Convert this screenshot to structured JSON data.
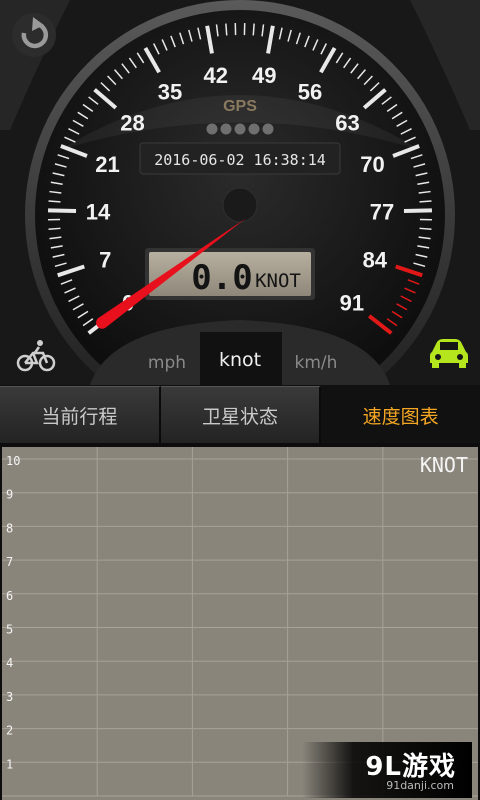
{
  "gauge": {
    "ticks": [
      "0",
      "7",
      "14",
      "21",
      "28",
      "35",
      "42",
      "49",
      "56",
      "63",
      "70",
      "77",
      "84",
      "91"
    ],
    "gps_label": "GPS",
    "datetime": "2016-06-02 16:38:14",
    "speed_value": "0.0",
    "speed_unit": "KNOT",
    "needle_speed": 0
  },
  "icons": {
    "refresh": "refresh-icon",
    "bicycle": "bicycle-icon",
    "car": "car-icon"
  },
  "colors": {
    "needle": "#e8101c",
    "redline": "#e01818",
    "active_tab": "#f5a623",
    "car_icon": "#b5e61d",
    "chart_bg": "#8a857b"
  },
  "units": {
    "mph": "mph",
    "knot": "knot",
    "kmh": "km/h",
    "selected": "knot"
  },
  "tabs": [
    {
      "label": "当前行程",
      "active": false
    },
    {
      "label": "卫星状态",
      "active": false
    },
    {
      "label": "速度图表",
      "active": true
    }
  ],
  "chart_data": {
    "type": "line",
    "unit_label": "KNOT",
    "y_ticks": [
      "10",
      "9",
      "8",
      "7",
      "6",
      "5",
      "4",
      "3",
      "2",
      "1"
    ],
    "ylim": [
      0,
      10
    ],
    "grid": true,
    "series": []
  },
  "watermark": {
    "main": "9L游戏",
    "sub": "91danji.com"
  }
}
